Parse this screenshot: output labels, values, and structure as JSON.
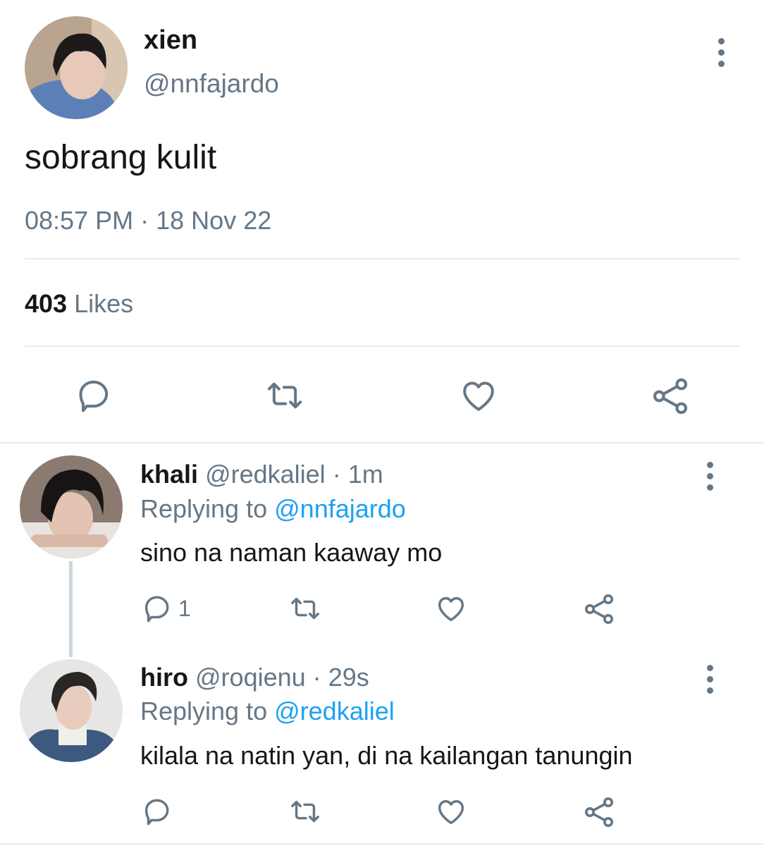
{
  "tweet": {
    "display_name": "xien",
    "handle": "@nnfajardo",
    "text": "sobrang kulit",
    "time": "08:57 PM",
    "separator": "·",
    "date": "18 Nov 22",
    "likes_count": "403",
    "likes_label": "Likes",
    "avatar": "avatar-photo"
  },
  "replies": [
    {
      "display_name": "khali",
      "handle": "@redkaliel",
      "dot": "·",
      "age": "1m",
      "replying_prefix": "Replying to",
      "replying_to": "@nnfajardo",
      "text": "sino na naman kaaway mo",
      "reply_count": "1"
    },
    {
      "display_name": "hiro",
      "handle": "@roqienu",
      "dot": "·",
      "age": "29s",
      "replying_prefix": "Replying to",
      "replying_to": "@redkaliel",
      "text": "kilala na natin yan, di na kailangan tanungin",
      "reply_count": ""
    }
  ],
  "icons": [
    "more-vertical-icon",
    "reply-icon",
    "retweet-icon",
    "like-icon",
    "share-icon"
  ],
  "colors": {
    "text": "#14171a",
    "secondary": "#657786",
    "link": "#1da1f2",
    "divider": "#e6ecf0"
  }
}
